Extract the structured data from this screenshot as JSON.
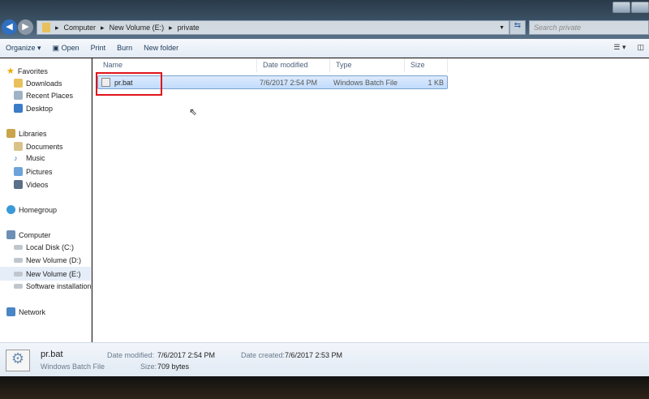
{
  "address": {
    "crumbs": [
      "Computer",
      "New Volume (E:)",
      "private"
    ],
    "search_placeholder": "Search private"
  },
  "toolbar": {
    "organize": "Organize ▾",
    "open": "Open",
    "print": "Print",
    "burn": "Burn",
    "new_folder": "New folder"
  },
  "sidebar": {
    "favorites": "Favorites",
    "downloads": "Downloads",
    "recent": "Recent Places",
    "desktop": "Desktop",
    "libraries": "Libraries",
    "documents": "Documents",
    "music": "Music",
    "pictures": "Pictures",
    "videos": "Videos",
    "homegroup": "Homegroup",
    "computer": "Computer",
    "c": "Local Disk (C:)",
    "d": "New Volume (D:)",
    "e": "New Volume (E:)",
    "sw": "Software installation",
    "network": "Network"
  },
  "columns": [
    "Name",
    "Date modified",
    "Type",
    "Size"
  ],
  "file": {
    "name": "pr.bat",
    "date": "7/6/2017 2:54 PM",
    "type": "Windows Batch File",
    "size": "1 KB"
  },
  "status": {
    "name": "pr.bat",
    "type": "Windows Batch File",
    "mod_label": "Date modified:",
    "mod": "7/6/2017 2:54 PM",
    "created_label": "Date created:",
    "created": "7/6/2017 2:53 PM",
    "size_label": "Size:",
    "size": "709 bytes"
  }
}
